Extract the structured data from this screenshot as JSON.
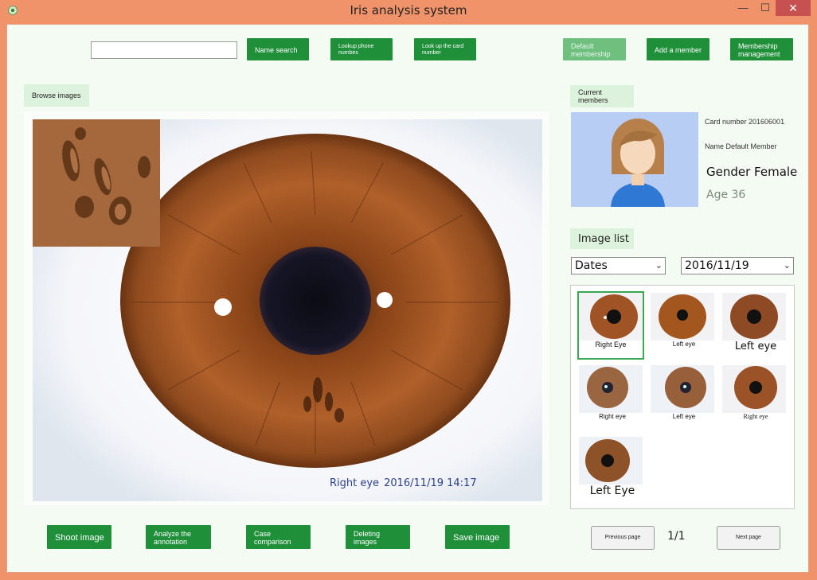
{
  "window": {
    "title": "Iris analysis system",
    "minimize": "—",
    "maximize": "☐",
    "close": "✕"
  },
  "toolbar": {
    "search_value": "",
    "name_search": "Name search",
    "lookup_phone": "Lookup phone numbes",
    "lookup_card": "Look up the card number",
    "default_membership": "Default membership",
    "add_member": "Add a member",
    "membership_management": "Membership management"
  },
  "viewer": {
    "tab": "Browse images",
    "caption_eye": "Right eye",
    "caption_datetime": "2016/11/19 14:17"
  },
  "member": {
    "tab": "Current members",
    "card_number": "Card number 201606001",
    "name": "Name Default Member",
    "gender": "Gender Female",
    "age": "Age 36"
  },
  "image_list": {
    "tab": "Image list",
    "filter_selected": "Dates",
    "date_selected": "2016/11/19",
    "thumbnails": [
      {
        "label": "Right Eye"
      },
      {
        "label": "Left eye"
      },
      {
        "label": "Left eye"
      },
      {
        "label": "Right eye"
      },
      {
        "label": "Left eye"
      },
      {
        "label": "Right eye"
      },
      {
        "label": "Left Eye"
      }
    ]
  },
  "pager": {
    "previous": "Previous page",
    "indicator": "1/1",
    "next": "Next page"
  },
  "actions": {
    "shoot": "Shoot image",
    "analyze": "Analyze the annotation",
    "compare": "Case comparison",
    "delete": "Deleting images",
    "save": "Save image"
  }
}
